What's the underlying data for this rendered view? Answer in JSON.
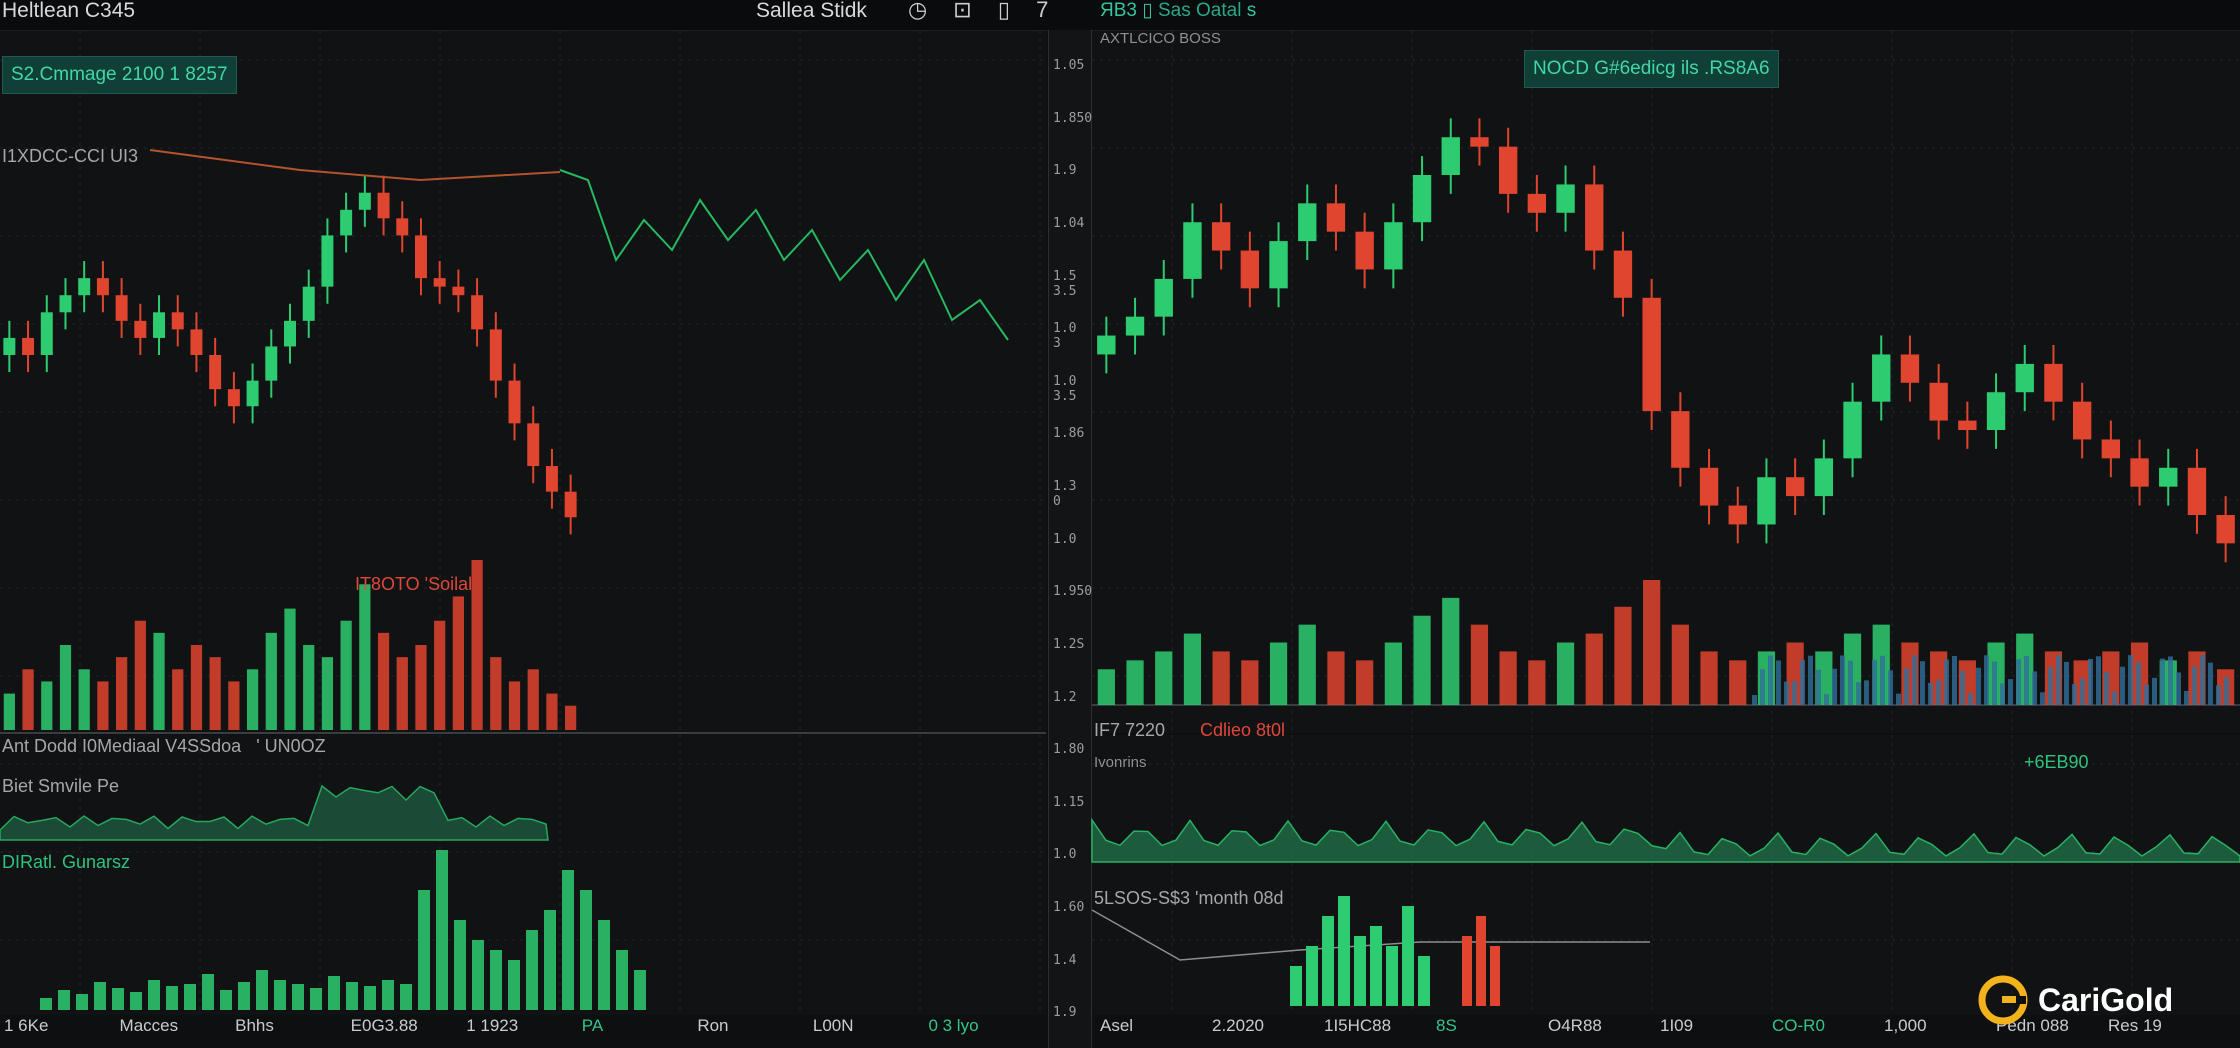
{
  "topbar": {
    "title": "Heltlean C345",
    "center": "Sallea Stidk",
    "icons": "◷ ⊡ ▯ 7",
    "right_ticker": "ЯВ3 ▯",
    "right_label": "Sas Oatal",
    "right_tail": "ѕ"
  },
  "left": {
    "badge": "S2.Cmmage 2100 1 8257",
    "title_label": "I1XDCC-CCI UI3",
    "volume_label": "IT8OTO 'Soilal",
    "sub_label_1": "Ant Dodd I0Mediaal V4SSdoa",
    "sub_label_1b": "' UN0OZ",
    "sub_label_2": "Biet Smvile Pe",
    "sub_label_3": "DIRatl. Gunarsz"
  },
  "right": {
    "header": "AXTLCICO  BOSS",
    "badge": "NOCD G#6edicg ils .RS8A6",
    "label_mid": "IF7 7220",
    "label_mid_red": "Cdlieo 8t0l",
    "indicator_label": "Ivonrins",
    "indicator_value": "+6EB90",
    "sub_label": "5LSOS-S$3 'month 08d"
  },
  "yaxis": [
    "1.05",
    "1.850",
    "1.9",
    "1.04",
    "1.5 3.5",
    "1.0 3",
    "1.0 3.5",
    "1.86",
    "1.3 0",
    "1.0",
    "1.950",
    "1.2S",
    "1.2",
    "1.80",
    "1.15",
    "1.0",
    "1.60",
    "1.4",
    "1.9"
  ],
  "xaxis": [
    {
      "label": "1 6Ke",
      "green": false
    },
    {
      "label": "Macces",
      "green": false
    },
    {
      "label": "Bhhs",
      "green": false
    },
    {
      "label": "E0G3.88",
      "green": false
    },
    {
      "label": "1 1923",
      "green": false
    },
    {
      "label": "PA",
      "green": true
    },
    {
      "label": "Ron",
      "green": false
    },
    {
      "label": "L00N",
      "green": false
    },
    {
      "label": "0 3 lyo",
      "green": true
    },
    {
      "label": "Asel",
      "green": false
    },
    {
      "label": "2.2020",
      "green": false
    },
    {
      "label": "1I5HC88",
      "green": false
    },
    {
      "label": "8S",
      "green": true
    },
    {
      "label": "O4R88",
      "green": false
    },
    {
      "label": "1I09",
      "green": false
    },
    {
      "label": "CO-R0",
      "green": true
    },
    {
      "label": "1,000",
      "green": false
    },
    {
      "label": "Pedn 088",
      "green": false
    },
    {
      "label": "Res 19",
      "green": false
    }
  ],
  "logo": {
    "text": "CariGold",
    "accent": "#f2b21c"
  },
  "colors": {
    "up": "#2ecc71",
    "down": "#e0452f",
    "bg": "#101213",
    "grid": "#22262a",
    "blue": "#2f6f9a"
  },
  "chart_data": [
    {
      "type": "candlestick",
      "title": "",
      "candles_close": [
        1.24,
        1.22,
        1.27,
        1.29,
        1.31,
        1.29,
        1.26,
        1.24,
        1.27,
        1.25,
        1.22,
        1.18,
        1.16,
        1.19,
        1.23,
        1.26,
        1.3,
        1.36,
        1.39,
        1.41,
        1.38,
        1.36,
        1.31,
        1.3,
        1.29,
        1.25,
        1.19,
        1.14,
        1.09,
        1.06,
        1.03
      ],
      "volume": [
        3,
        5,
        4,
        7,
        5,
        4,
        6,
        9,
        8,
        5,
        7,
        6,
        4,
        5,
        8,
        10,
        7,
        6,
        9,
        12,
        8,
        6,
        7,
        9,
        11,
        14,
        6,
        4,
        5,
        3,
        2
      ]
    },
    {
      "type": "candlestick",
      "title": "",
      "candles_close": [
        1.4,
        1.42,
        1.46,
        1.52,
        1.49,
        1.45,
        1.5,
        1.54,
        1.51,
        1.47,
        1.52,
        1.57,
        1.61,
        1.6,
        1.55,
        1.53,
        1.56,
        1.49,
        1.44,
        1.32,
        1.26,
        1.22,
        1.2,
        1.25,
        1.23,
        1.27,
        1.33,
        1.38,
        1.35,
        1.31,
        1.3,
        1.34,
        1.37,
        1.33,
        1.29,
        1.27,
        1.24,
        1.26,
        1.21,
        1.18
      ],
      "volume": [
        4,
        5,
        6,
        8,
        6,
        5,
        7,
        9,
        6,
        5,
        7,
        10,
        12,
        9,
        6,
        5,
        7,
        8,
        11,
        14,
        9,
        6,
        5,
        6,
        7,
        6,
        8,
        9,
        7,
        6,
        5,
        7,
        8,
        6,
        5,
        6,
        7,
        5,
        6,
        4
      ]
    }
  ]
}
